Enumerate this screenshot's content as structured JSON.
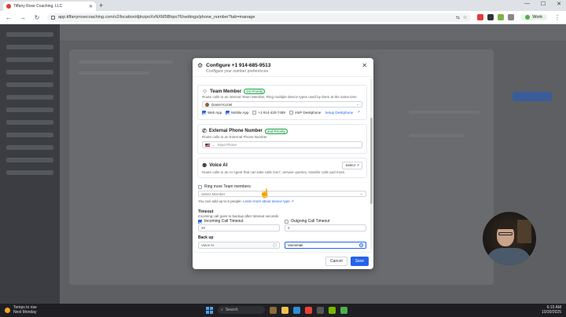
{
  "browser": {
    "tab_title": "Tiffany Rose Coaching, LLC",
    "url": "app.tiffanyrosecoaching.com/v2/location/djtnzpoXvNXM5Bhpo76/settings/phone_number?tab=manage",
    "profile_label": "Work"
  },
  "modal": {
    "title": "Configure +1 914-685-9513",
    "subtitle": "Configure your number preferences",
    "team_member": {
      "title": "Team Member",
      "badge": "1st Priority",
      "description": "Route calls to an internal Team Member. Ring multiple device types used by them at the same time",
      "selected_member": "Daniel Koziel",
      "devices": {
        "web_app": "Web App",
        "mobile_app": "Mobile App",
        "phone": "+1 914-420-7489",
        "voip": "VoIP Deskphone",
        "setup_link": "Setup Deskphone"
      }
    },
    "external_phone": {
      "title": "External Phone Number",
      "badge": "2nd Priority",
      "description": "Route calls to an External Phone Number",
      "placeholder": "Input Phone"
    },
    "voice_ai": {
      "title": "Voice AI",
      "description": "Route calls to an AI Agent that can take calls 24x7, answer queries, transfer calls and more.",
      "select_label": "Select"
    },
    "ring_more": {
      "label": "Ring more Team members",
      "placeholder": "Select Member",
      "note": "You can add up to 6 people.",
      "learn_more": "Learn more about device type"
    },
    "timeout": {
      "title": "Timeout",
      "description": "Incoming call goes to backup after timeout seconds",
      "incoming_label": "Incoming Call Timeout",
      "incoming_value": "20",
      "outgoing_label": "Outgoing Call Timeout",
      "outgoing_value": "0"
    },
    "backup": {
      "title": "Back up",
      "option_voice_ai": "Voice AI",
      "option_voicemail": "Voicemail"
    },
    "cancel_label": "Cancel",
    "save_label": "Save"
  },
  "taskbar": {
    "weather_line1": "Temps to rise",
    "weather_line2": "Next Monday",
    "search_placeholder": "Search",
    "time": "6:15 AM",
    "date": "10/30/2025"
  },
  "colors": {
    "accent": "#2563eb",
    "priority_badge": "#16a34a"
  }
}
